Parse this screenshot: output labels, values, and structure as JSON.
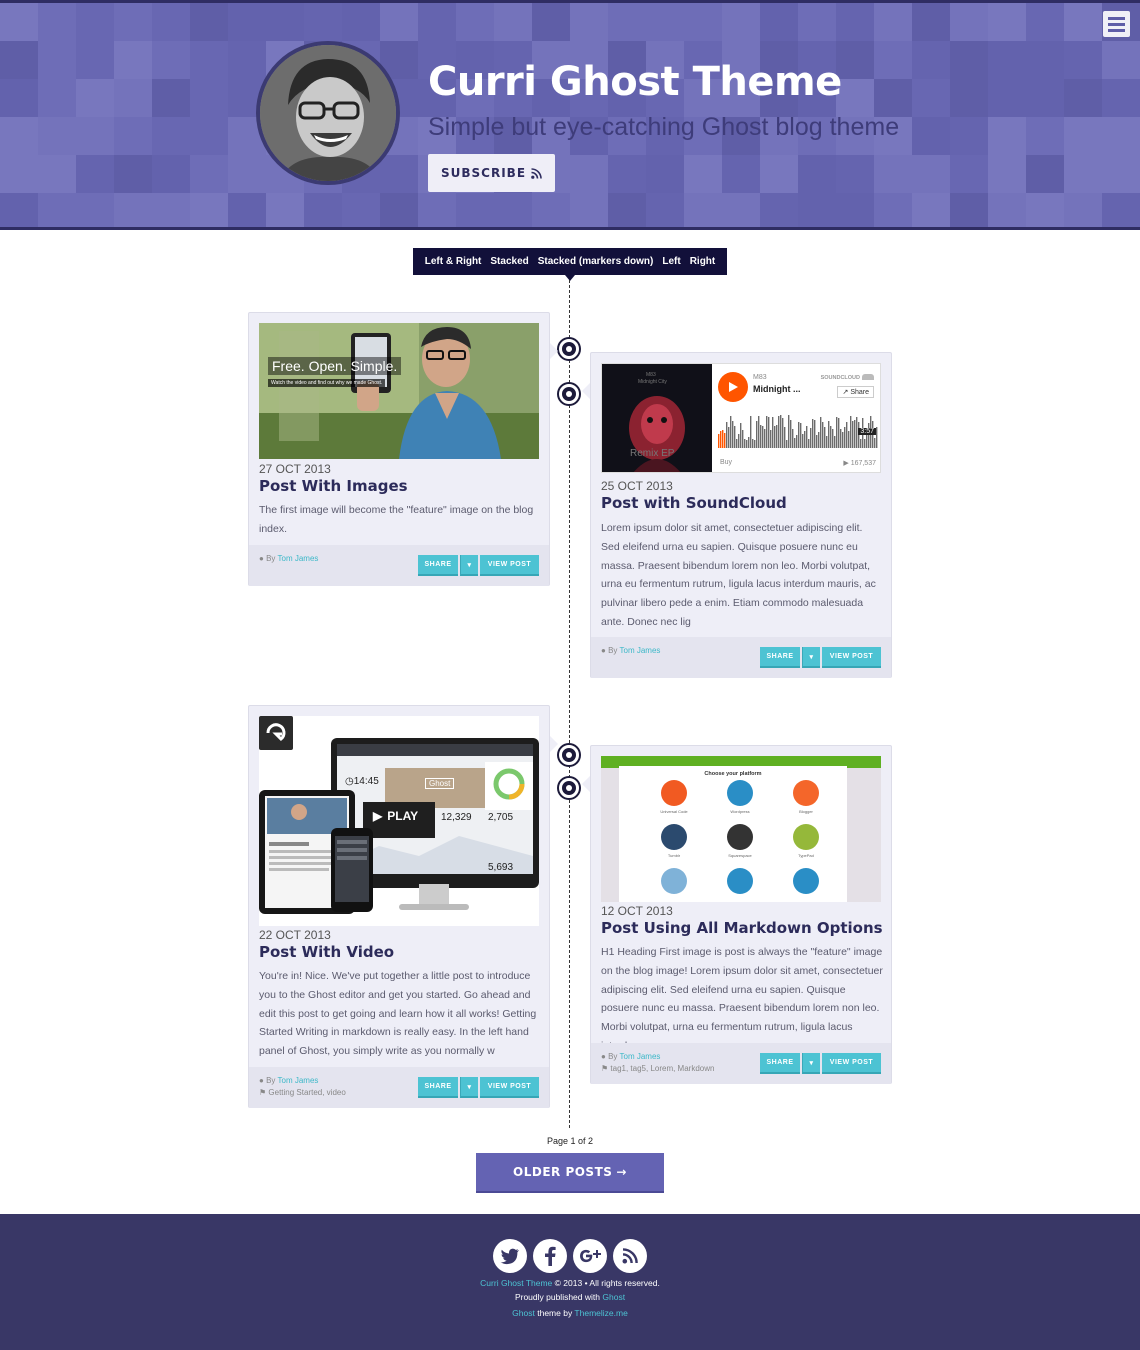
{
  "header": {
    "title": "Curri Ghost Theme",
    "subtitle": "Simple but eye-catching Ghost blog theme",
    "subscribe_label": "SUBSCRIBE",
    "colors": {
      "header_bg": "#6d6cb6",
      "header_border": "#2f2d63"
    }
  },
  "layout_switcher": {
    "options": [
      "Left & Right",
      "Stacked",
      "Stacked (markers down)",
      "Left",
      "Right"
    ]
  },
  "posts": [
    {
      "date": "27 OCT 2013",
      "title": "Post With Images",
      "excerpt": "The first image will become the \"feature\" image on the blog index.",
      "author_prefix": "By",
      "author": "Tom James",
      "tags": "",
      "share_label": "SHARE",
      "view_label": "VIEW POST",
      "media": {
        "headline": "Free. Open. Simple.",
        "caption": "Watch the video and find out why we made Ghost."
      }
    },
    {
      "date": "25 OCT 2013",
      "title": "Post with SoundCloud",
      "excerpt": "Lorem ipsum dolor sit amet, consectetuer adipiscing elit. Sed eleifend urna eu sapien. Quisque posuere nunc eu massa. Praesent bibendum lorem non leo. Morbi volutpat, urna eu fermentum rutrum, ligula lacus interdum mauris, ac pulvinar libero pede a enim. Etiam commodo malesuada ante. Donec nec lig",
      "author_prefix": "By",
      "author": "Tom James",
      "tags": "",
      "share_label": "SHARE",
      "view_label": "VIEW POST",
      "media": {
        "artist": "M83",
        "track": "Midnight ...",
        "brand": "SOUNDCLOUD",
        "share": "Share",
        "duration": "3:57",
        "buy": "Buy",
        "plays": "167,537",
        "cover_artist": "M83",
        "cover_title": "Midnight City",
        "cover_text": "Remix EP"
      }
    },
    {
      "date": "22 OCT 2013",
      "title": "Post With Video",
      "excerpt": "You're in! Nice. We've put together a little post to introduce you to the Ghost editor and get you started. Go ahead and edit this post to get going and learn how it all works! Getting Started Writing in markdown is really easy. In the left hand panel of Ghost, you simply write as you normally w",
      "author_prefix": "By",
      "author": "Tom James",
      "tags": "Getting Started, video",
      "share_label": "SHARE",
      "view_label": "VIEW POST",
      "media": {
        "play": "PLAY",
        "clock": "14:45",
        "stat1": "12,329",
        "stat2": "2,705",
        "stat3": "5,693",
        "brand": "Ghost"
      }
    },
    {
      "date": "12 OCT 2013",
      "title": "Post Using All Markdown Options",
      "excerpt": "H1 Heading First image is post is always the \"feature\" image on the blog image! Lorem ipsum dolor sit amet, consectetuer adipiscing elit. Sed eleifend urna eu sapien. Quisque posuere nunc eu massa. Praesent bibendum lorem non leo. Morbi volutpat, urna eu fermentum rutrum, ligula lacus interdum m",
      "author_prefix": "By",
      "author": "Tom James",
      "tags": "tag1, tag5, Lorem, Markdown",
      "share_label": "SHARE",
      "view_label": "VIEW POST",
      "media": {
        "heading": "Choose your platform",
        "platforms": [
          "Universal Code",
          "Wordpress",
          "Blogger",
          "Tumblr",
          "Squarespace",
          "TypePad"
        ]
      }
    }
  ],
  "pagination": {
    "label": "Page 1 of 2",
    "older_label": "OLDER POSTS"
  },
  "footer": {
    "site_link": "Curri Ghost Theme",
    "copyright": "© 2013 • All rights reserved.",
    "published_prefix": "Proudly published with",
    "published_link": "Ghost",
    "theme_link": "Ghost",
    "theme_mid": "theme by",
    "theme_author": "Themelize.me",
    "social_icons": [
      "twitter-icon",
      "facebook-icon",
      "google-plus-icon",
      "rss-icon"
    ]
  },
  "colors": {
    "accent": "#4dc3d3",
    "title": "#2c2b5a",
    "footer_bg": "#393766",
    "older_btn": "#6463b3"
  }
}
